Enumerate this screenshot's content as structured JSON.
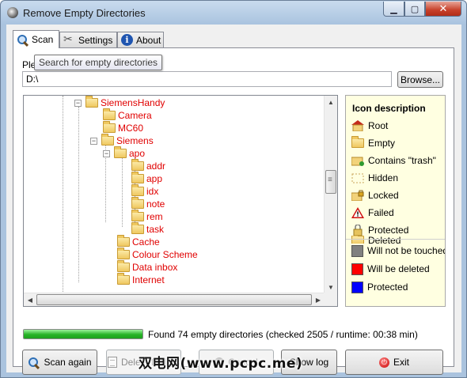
{
  "window": {
    "title": "Remove Empty Directories",
    "controls": {
      "minimize": "▁",
      "maximize": "▢",
      "close": "✕"
    }
  },
  "tabs": [
    {
      "label": "Scan",
      "icon": "magnifier-icon",
      "active": true
    },
    {
      "label": "Settings",
      "icon": "tools-icon",
      "active": false
    },
    {
      "label": "About",
      "icon": "about-icon",
      "active": false
    }
  ],
  "scan": {
    "prompt_label": "Ple",
    "tooltip": "Search for empty directories",
    "path_value": "D:\\",
    "browse_label": "Browse..."
  },
  "tree": {
    "items": [
      {
        "label": "SiemensHandy",
        "level": 0,
        "expander": "−"
      },
      {
        "label": "Camera",
        "level": 1,
        "expander": ""
      },
      {
        "label": "MC60",
        "level": 1,
        "expander": ""
      },
      {
        "label": "Siemens",
        "level": 1,
        "expander": "−"
      },
      {
        "label": "apo",
        "level": 2,
        "expander": "−"
      },
      {
        "label": "addr",
        "level": 3,
        "expander": ""
      },
      {
        "label": "app",
        "level": 3,
        "expander": ""
      },
      {
        "label": "idx",
        "level": 3,
        "expander": ""
      },
      {
        "label": "note",
        "level": 3,
        "expander": ""
      },
      {
        "label": "rem",
        "level": 3,
        "expander": ""
      },
      {
        "label": "task",
        "level": 3,
        "expander": ""
      },
      {
        "label": "Cache",
        "level": 2,
        "expander": ""
      },
      {
        "label": "Colour Scheme",
        "level": 2,
        "expander": ""
      },
      {
        "label": "Data inbox",
        "level": 2,
        "expander": ""
      },
      {
        "label": "Internet",
        "level": 2,
        "expander": ""
      }
    ],
    "scroll": {
      "up": "▲",
      "down": "▼",
      "left": "◀",
      "right": "▶"
    }
  },
  "legend": {
    "title": "Icon description",
    "icons": [
      {
        "label": "Root",
        "icon": "root-folder-icon"
      },
      {
        "label": "Empty",
        "icon": "empty-folder-icon"
      },
      {
        "label": "Contains \"trash\"",
        "icon": "trash-folder-icon"
      },
      {
        "label": "Hidden",
        "icon": "hidden-folder-icon"
      },
      {
        "label": "Locked",
        "icon": "locked-folder-icon"
      },
      {
        "label": "Failed",
        "icon": "warning-icon"
      },
      {
        "label": "Protected",
        "icon": "padlock-icon"
      },
      {
        "label": "Deleted",
        "icon": "deleted-folder-icon"
      }
    ],
    "colors": [
      {
        "label": "Will not be touched",
        "color": "#808080"
      },
      {
        "label": "Will be deleted",
        "color": "#ff0000"
      },
      {
        "label": "Protected",
        "color": "#0000ff"
      }
    ]
  },
  "status": {
    "progress_percent": 100,
    "text": "Found 74 empty directories (checked 2505 / runtime: 00:38 min)"
  },
  "buttons": {
    "scan_again": "Scan again",
    "delete_folders": "Delete folders",
    "cancel": "Cancel",
    "show_log": "Show log",
    "exit": "Exit"
  },
  "watermark": "双电网(www.pcpc.me)",
  "colors": {
    "tree_text": "#e00000",
    "legend_bg": "#ffffe1",
    "progress": "#26b326"
  }
}
